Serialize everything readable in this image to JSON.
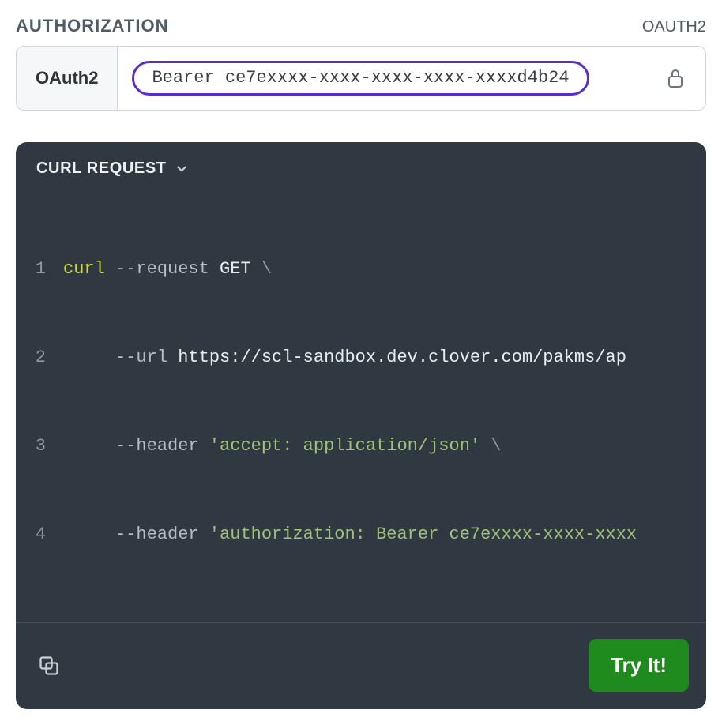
{
  "auth": {
    "section_title": "AUTHORIZATION",
    "scheme_label": "OAUTH2",
    "type_label": "OAuth2",
    "token": "Bearer ce7exxxx-xxxx-xxxx-xxxx-xxxxd4b24"
  },
  "code": {
    "header_title": "CURL REQUEST",
    "lines": [
      {
        "n": "1",
        "cmd": "curl",
        "opt": "--request",
        "verb": "GET",
        "tail": "\\"
      },
      {
        "n": "2",
        "indent": "     ",
        "opt": "--url",
        "url": "https://scl-sandbox.dev.clover.com/pakms/ap"
      },
      {
        "n": "3",
        "indent": "     ",
        "opt": "--header",
        "str": "'accept: application/json'",
        "tail": " \\"
      },
      {
        "n": "4",
        "indent": "     ",
        "opt": "--header",
        "str": "'authorization: Bearer ce7exxxx-xxxx-xxxx"
      }
    ],
    "try_label": "Try It!"
  }
}
